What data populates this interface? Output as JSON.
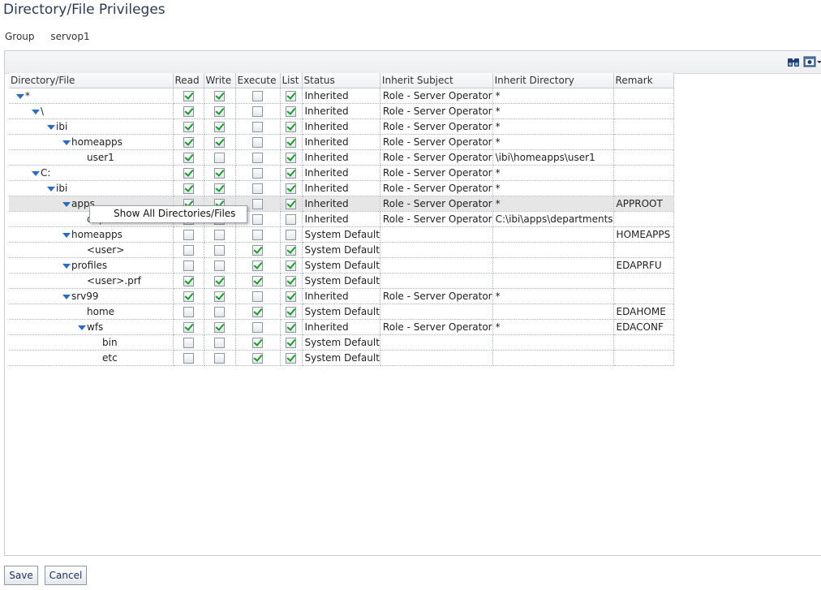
{
  "page": {
    "title": "Directory/File Privileges"
  },
  "group": {
    "label": "Group",
    "value": "servop1"
  },
  "toolbar": {
    "icons": [
      "binoculars-icon",
      "view-icon",
      "dropdown-arrow-icon"
    ]
  },
  "table": {
    "columns": [
      "Directory/File",
      "Read",
      "Write",
      "Execute",
      "List",
      "Status",
      "Inherit Subject",
      "Inherit Directory",
      "Remark"
    ],
    "rows": [
      {
        "name": "*",
        "level": 0,
        "expanded": true,
        "read": true,
        "write": true,
        "execute": false,
        "list": true,
        "status": "Inherited",
        "subject": "Role - Server Operator",
        "directory": "*",
        "remark": ""
      },
      {
        "name": "\\",
        "level": 1,
        "expanded": true,
        "read": true,
        "write": true,
        "execute": false,
        "list": true,
        "status": "Inherited",
        "subject": "Role - Server Operator",
        "directory": "*",
        "remark": ""
      },
      {
        "name": "ibi",
        "level": 2,
        "expanded": true,
        "read": true,
        "write": true,
        "execute": false,
        "list": true,
        "status": "Inherited",
        "subject": "Role - Server Operator",
        "directory": "*",
        "remark": ""
      },
      {
        "name": "homeapps",
        "level": 3,
        "expanded": true,
        "read": true,
        "write": true,
        "execute": false,
        "list": true,
        "status": "Inherited",
        "subject": "Role - Server Operator",
        "directory": "*",
        "remark": ""
      },
      {
        "name": "user1",
        "level": 4,
        "expanded": false,
        "read": true,
        "write": false,
        "execute": false,
        "list": true,
        "status": "Inherited",
        "subject": "Role - Server Operator",
        "directory": "\\ibi\\homeapps\\user1",
        "remark": ""
      },
      {
        "name": "C:",
        "level": 1,
        "expanded": true,
        "read": true,
        "write": true,
        "execute": false,
        "list": true,
        "status": "Inherited",
        "subject": "Role - Server Operator",
        "directory": "*",
        "remark": ""
      },
      {
        "name": "ibi",
        "level": 2,
        "expanded": true,
        "read": true,
        "write": true,
        "execute": false,
        "list": true,
        "status": "Inherited",
        "subject": "Role - Server Operator",
        "directory": "*",
        "remark": ""
      },
      {
        "name": "apps",
        "level": 3,
        "expanded": true,
        "read": true,
        "write": true,
        "execute": false,
        "list": true,
        "status": "Inherited",
        "subject": "Role - Server Operator",
        "directory": "*",
        "remark": "APPROOT",
        "selected": true
      },
      {
        "name": "departments",
        "level": 4,
        "expanded": false,
        "read": false,
        "write": false,
        "execute": false,
        "list": false,
        "status": "Inherited",
        "subject": "Role - Server Operator",
        "directory": "C:\\ibi\\apps\\departments",
        "remark": ""
      },
      {
        "name": "homeapps",
        "level": 3,
        "expanded": true,
        "read": false,
        "write": false,
        "execute": false,
        "list": false,
        "status": "System Default",
        "subject": "",
        "directory": "",
        "remark": "HOMEAPPS"
      },
      {
        "name": "<user>",
        "level": 4,
        "expanded": false,
        "read": false,
        "write": false,
        "execute": true,
        "list": true,
        "status": "System Default",
        "subject": "",
        "directory": "",
        "remark": ""
      },
      {
        "name": "profiles",
        "level": 3,
        "expanded": true,
        "read": false,
        "write": false,
        "execute": true,
        "list": true,
        "status": "System Default",
        "subject": "",
        "directory": "",
        "remark": "EDAPRFU"
      },
      {
        "name": "<user>.prf",
        "level": 4,
        "expanded": false,
        "read": true,
        "write": true,
        "execute": true,
        "list": true,
        "status": "System Default",
        "subject": "",
        "directory": "",
        "remark": ""
      },
      {
        "name": "srv99",
        "level": 3,
        "expanded": true,
        "read": true,
        "write": true,
        "execute": false,
        "list": true,
        "status": "Inherited",
        "subject": "Role - Server Operator",
        "directory": "*",
        "remark": ""
      },
      {
        "name": "home",
        "level": 4,
        "expanded": false,
        "read": false,
        "write": false,
        "execute": true,
        "list": true,
        "status": "System Default",
        "subject": "",
        "directory": "",
        "remark": "EDAHOME"
      },
      {
        "name": "wfs",
        "level": 4,
        "expanded": true,
        "read": true,
        "write": true,
        "execute": false,
        "list": true,
        "status": "Inherited",
        "subject": "Role - Server Operator",
        "directory": "*",
        "remark": "EDACONF"
      },
      {
        "name": "bin",
        "level": 5,
        "expanded": false,
        "read": false,
        "write": false,
        "execute": true,
        "list": true,
        "status": "System Default",
        "subject": "",
        "directory": "",
        "remark": ""
      },
      {
        "name": "etc",
        "level": 5,
        "expanded": false,
        "read": false,
        "write": false,
        "execute": true,
        "list": true,
        "status": "System Default",
        "subject": "",
        "directory": "",
        "remark": ""
      }
    ]
  },
  "context_menu": {
    "item": "Show All Directories/Files"
  },
  "buttons": {
    "save": "Save",
    "cancel": "Cancel"
  },
  "colors": {
    "title": "#2b3a55",
    "tree_arrow": "#2a6cc4",
    "check": "#1c9a2b",
    "selected_row": "#e6e6e6"
  }
}
